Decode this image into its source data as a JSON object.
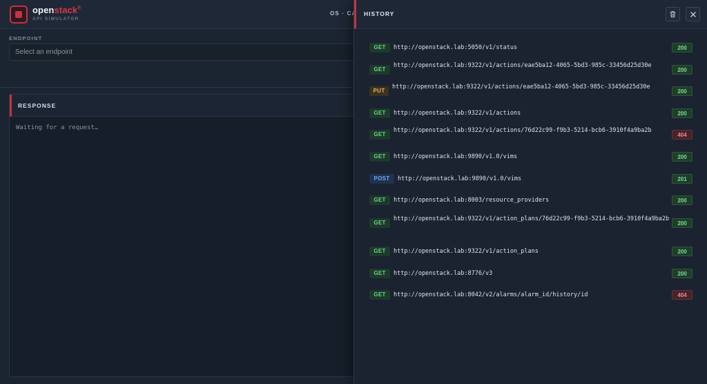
{
  "app": {
    "brand_prefix": "open",
    "brand_accent": "stack",
    "brand_mark": "®",
    "sub_brand": "API SIMULATOR",
    "top_right": "OS · CA"
  },
  "endpoint": {
    "label": "ENDPOINT",
    "placeholder": "Select an endpoint"
  },
  "response": {
    "title": "RESPONSE",
    "body": "Waiting for a request…"
  },
  "history": {
    "title": "HISTORY",
    "trash_icon": "trash-icon",
    "close_icon": "close-icon",
    "items": [
      {
        "method": "GET",
        "url": "http://openstack.lab:5050/v1/status",
        "status": "200"
      },
      {
        "method": "GET",
        "url": "http://openstack.lab:9322/v1/actions/eae5ba12-4065-5bd3-985c-33456d25d30e",
        "status": "200"
      },
      {
        "method": "PUT",
        "url": "http://openstack.lab:9322/v1/actions/eae5ba12-4065-5bd3-985c-33456d25d30e",
        "status": "200"
      },
      {
        "method": "GET",
        "url": "http://openstack.lab:9322/v1/actions",
        "status": "200"
      },
      {
        "method": "GET",
        "url": "http://openstack.lab:9322/v1/actions/76d22c99-f9b3-5214-bcb6-3910f4a9ba2b",
        "status": "404"
      },
      {
        "method": "GET",
        "url": "http://openstack.lab:9890/v1.0/vims",
        "status": "200"
      },
      {
        "method": "POST",
        "url": "http://openstack.lab:9890/v1.0/vims",
        "status": "201"
      },
      {
        "method": "GET",
        "url": "http://openstack.lab:8003/resource_providers",
        "status": "200"
      },
      {
        "method": "GET",
        "url": "http://openstack.lab:9322/v1/action_plans/76d22c99-f9b3-5214-bcb6-3910f4a9ba2b",
        "status": "200"
      },
      {
        "method": "GET",
        "url": "http://openstack.lab:9322/v1/action_plans",
        "status": "200"
      },
      {
        "method": "GET",
        "url": "http://openstack.lab:8776/v3",
        "status": "200"
      },
      {
        "method": "GET",
        "url": "http://openstack.lab:8042/v2/alarms/alarm_id/history/id",
        "status": "404"
      }
    ]
  }
}
